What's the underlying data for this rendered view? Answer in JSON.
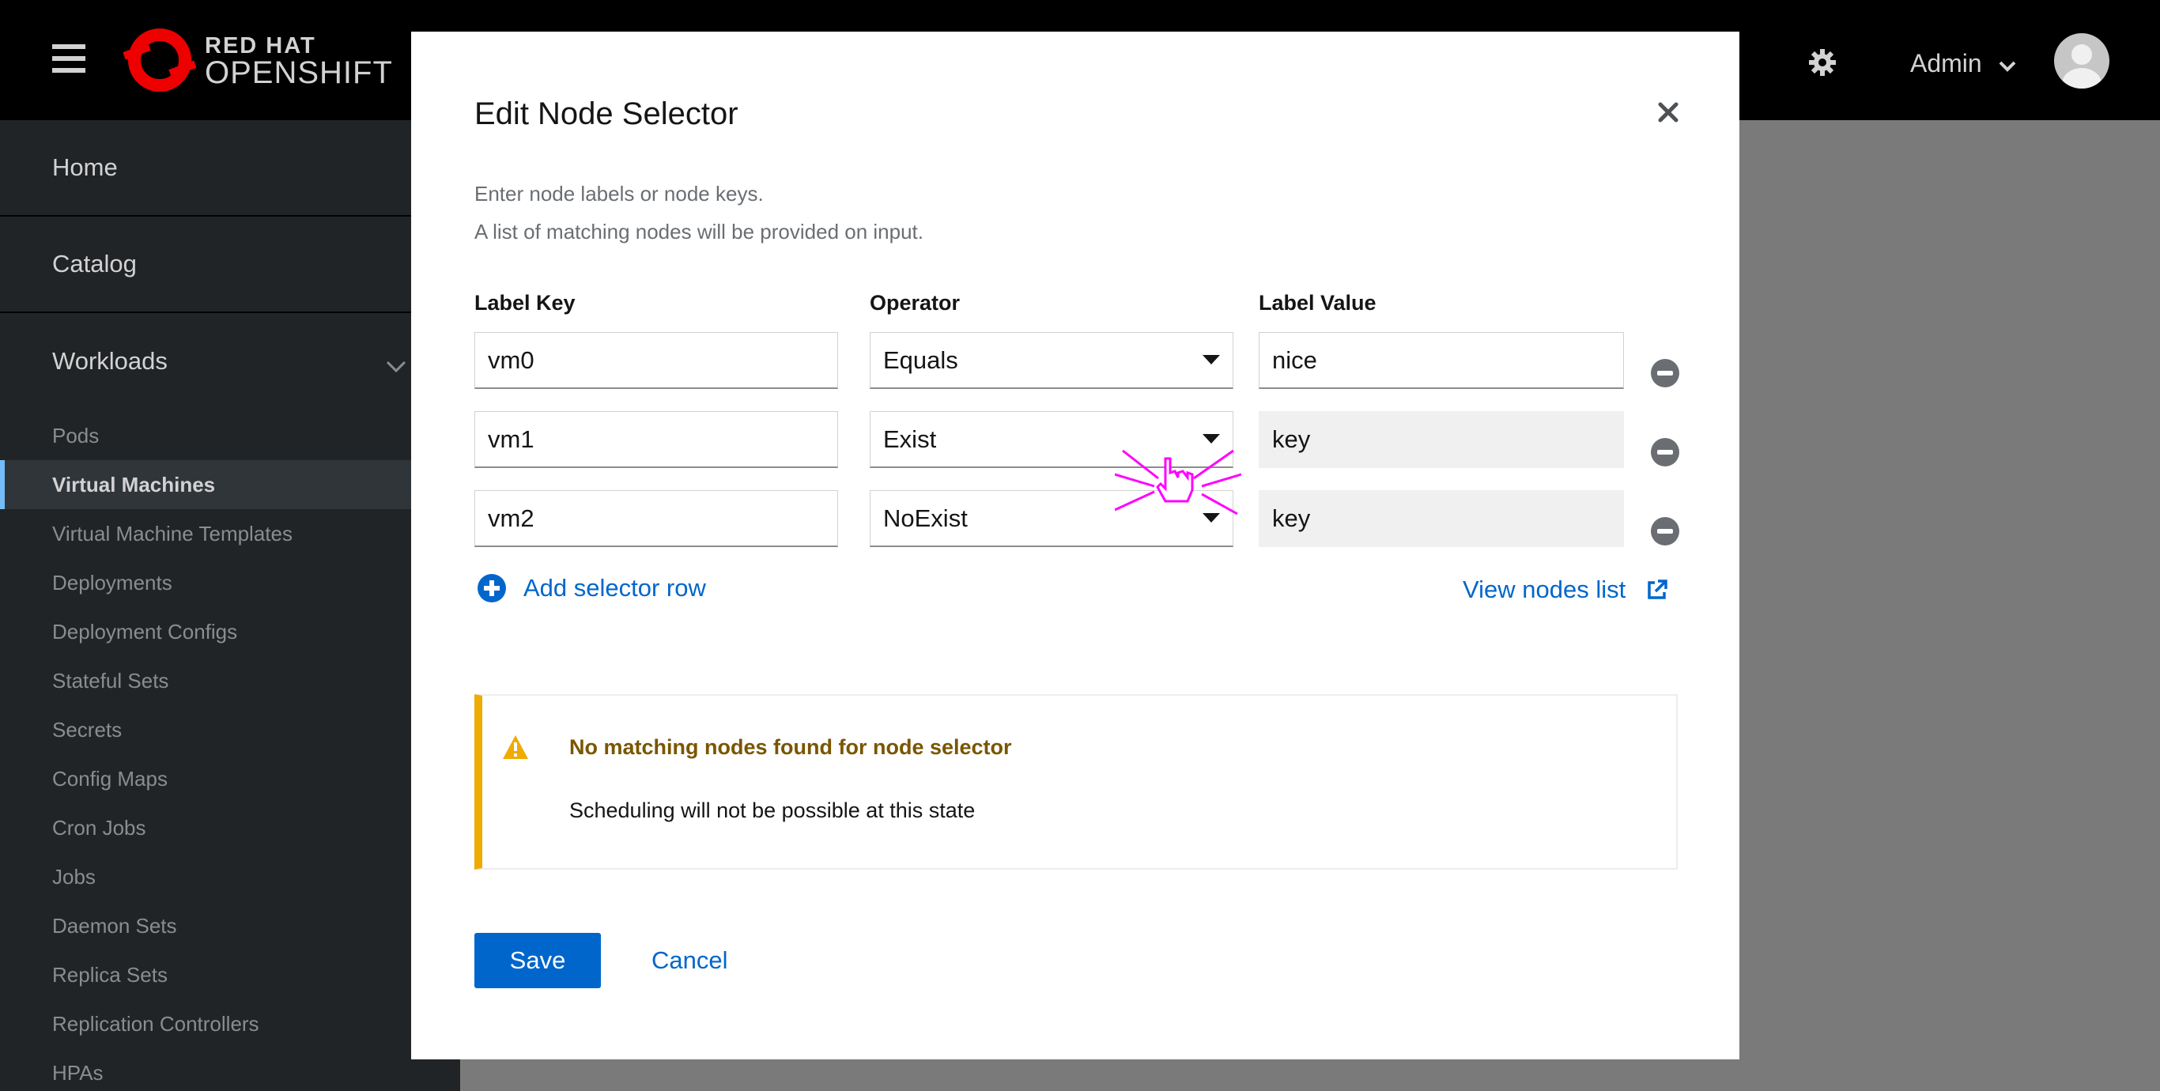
{
  "masthead": {
    "logo_top": "RED HAT",
    "logo_bottom": "OPENSHIFT",
    "user_label": "Admin",
    "icons": [
      "hamburger-icon",
      "gear-icon",
      "chevron-down-icon",
      "avatar"
    ]
  },
  "sidebar": {
    "sections": [
      {
        "label": "Home"
      },
      {
        "label": "Catalog"
      },
      {
        "label": "Workloads"
      }
    ],
    "items": [
      {
        "label": "Pods"
      },
      {
        "label": "Virtual Machines",
        "active": true
      },
      {
        "label": "Virtual Machine Templates"
      },
      {
        "label": "Deployments"
      },
      {
        "label": "Deployment Configs"
      },
      {
        "label": "Stateful Sets"
      },
      {
        "label": "Secrets"
      },
      {
        "label": "Config Maps"
      },
      {
        "label": "Cron Jobs"
      },
      {
        "label": "Jobs"
      },
      {
        "label": "Daemon Sets"
      },
      {
        "label": "Replica Sets"
      },
      {
        "label": "Replication Controllers"
      },
      {
        "label": "HPAs"
      }
    ]
  },
  "modal": {
    "title": "Edit Node Selector",
    "description_line1": "Enter node labels or node keys.",
    "description_line2": "A list of matching nodes will be provided on input.",
    "columns": {
      "label_key": "Label Key",
      "operator": "Operator",
      "label_value": "Label Value"
    },
    "rows": [
      {
        "key": "vm0",
        "operator": "Equals",
        "value": "nice",
        "value_disabled": false
      },
      {
        "key": "vm1",
        "operator": "Exist",
        "value": "key",
        "value_disabled": true
      },
      {
        "key": "vm2",
        "operator": "NoExist",
        "value": "key",
        "value_disabled": true
      }
    ],
    "add_row_label": "Add selector row",
    "view_nodes_label": "View nodes list",
    "alert": {
      "title": "No matching nodes found for node selector",
      "body": "Scheduling will not be possible at this state",
      "color": "#f0ab00"
    },
    "save_label": "Save",
    "cancel_label": "Cancel"
  },
  "colors": {
    "primary": "#0066cc",
    "warning": "#f0ab00",
    "masthead": "#000000",
    "sidebar": "#212427"
  }
}
